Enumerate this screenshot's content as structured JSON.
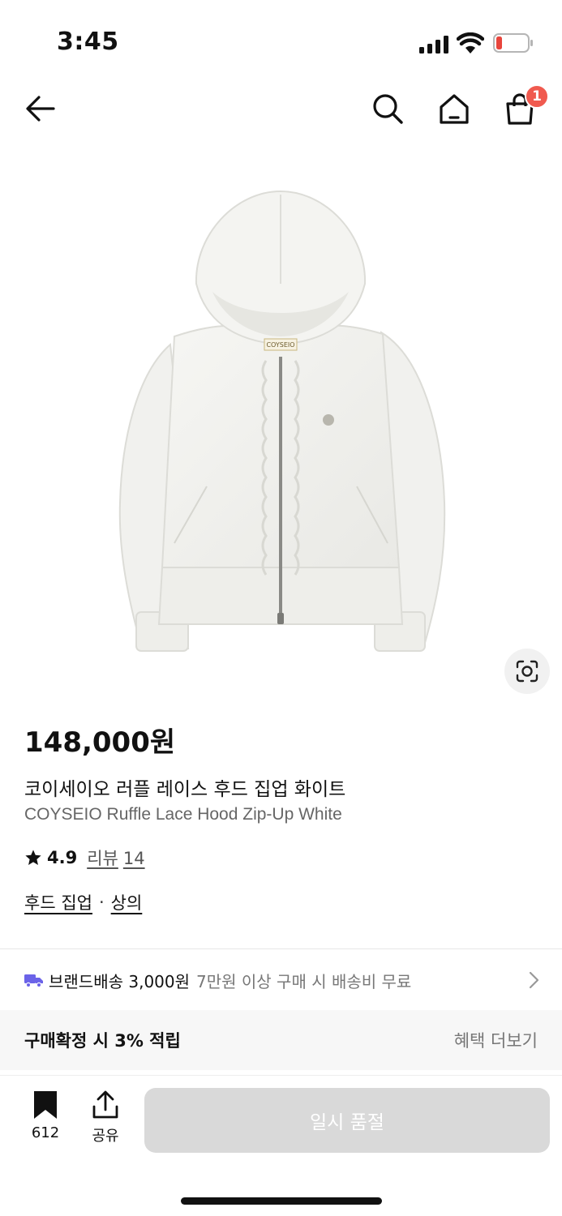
{
  "status_bar": {
    "time": "3:45",
    "icons": [
      "cellular-signal-icon",
      "wifi-icon",
      "battery-low-icon"
    ]
  },
  "nav": {
    "icons": [
      "arrow-left-icon",
      "search-icon",
      "home-icon",
      "shopping-bag-icon"
    ],
    "cart_count": "1"
  },
  "product": {
    "image_brand_tag": "COYSEIO",
    "price": "148,000원",
    "name_ko": "코이세이오 러플 레이스 후드 집업 화이트",
    "name_en": "COYSEIO Ruffle Lace Hood Zip-Up White",
    "rating": "4.9",
    "review_label": "리뷰",
    "review_count": "14",
    "categories": [
      "후드 집업",
      "상의"
    ],
    "category_separator": "·"
  },
  "shipping": {
    "label": "브랜드배송 3,000원",
    "note": "7만원 이상 구매 시 배송비 무료"
  },
  "points": {
    "label": "구매확정 시 3% 적립",
    "link": "혜택 더보기"
  },
  "bottom_bar": {
    "bookmark_count": "612",
    "share_label": "공유",
    "cta_label": "일시 품절"
  },
  "colors": {
    "badge": "#f05a4f",
    "truck": "#6b63e8",
    "cta_disabled": "#d9d9d9"
  }
}
